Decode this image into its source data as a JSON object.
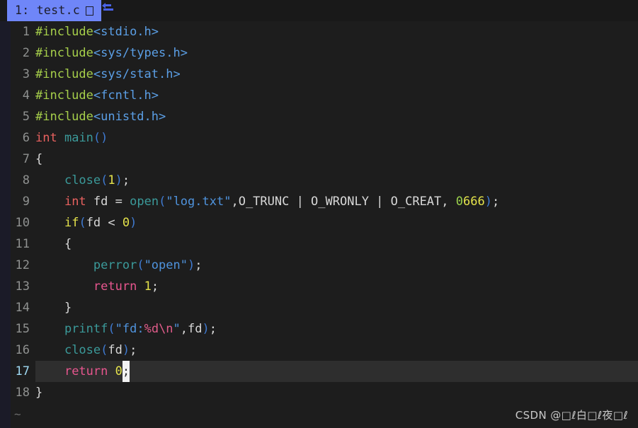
{
  "window": {
    "background": "#1d1d1d",
    "gutter_strip_color": "#1b1b28"
  },
  "tabline": {
    "background": "#191919",
    "active_tab": {
      "label": "1: test.c",
      "modified_glyph": "box-glyph",
      "background": "#6f86f8",
      "text_color": "#1c1c28"
    },
    "fill_glyph_name": "arrow-left-bar-icon",
    "fill_glyph_color": "#4a63e8"
  },
  "editor": {
    "filename": "test.c",
    "language": "c",
    "cursor_line": 17,
    "cursor_column": 14,
    "cursor_char": ";",
    "current_line_highlight": "#2e2e2e",
    "lines": [
      {
        "number": "1",
        "tokens": [
          {
            "t": "#include",
            "c": "tk-pre"
          },
          {
            "t": "<stdio.h>",
            "c": "tk-header"
          }
        ]
      },
      {
        "number": "2",
        "tokens": [
          {
            "t": "#include",
            "c": "tk-pre"
          },
          {
            "t": "<sys/types.h>",
            "c": "tk-header"
          }
        ]
      },
      {
        "number": "3",
        "tokens": [
          {
            "t": "#include",
            "c": "tk-pre"
          },
          {
            "t": "<sys/stat.h>",
            "c": "tk-header"
          }
        ]
      },
      {
        "number": "4",
        "tokens": [
          {
            "t": "#include",
            "c": "tk-pre"
          },
          {
            "t": "<fcntl.h>",
            "c": "tk-header"
          }
        ]
      },
      {
        "number": "5",
        "tokens": [
          {
            "t": "#include",
            "c": "tk-pre"
          },
          {
            "t": "<unistd.h>",
            "c": "tk-header"
          }
        ]
      },
      {
        "number": "6",
        "tokens": [
          {
            "t": "int",
            "c": "tk-type"
          },
          {
            "t": " ",
            "c": "tk-ident"
          },
          {
            "t": "main",
            "c": "tk-func"
          },
          {
            "t": "()",
            "c": "tk-punct"
          }
        ]
      },
      {
        "number": "7",
        "tokens": [
          {
            "t": "{",
            "c": "tk-brace"
          }
        ]
      },
      {
        "number": "8",
        "tokens": [
          {
            "t": "    ",
            "c": "tk-ident"
          },
          {
            "t": "close",
            "c": "tk-func"
          },
          {
            "t": "(",
            "c": "tk-punct"
          },
          {
            "t": "1",
            "c": "tk-num"
          },
          {
            "t": ")",
            "c": "tk-punct"
          },
          {
            "t": ";",
            "c": "tk-semi"
          }
        ]
      },
      {
        "number": "9",
        "tokens": [
          {
            "t": "    ",
            "c": "tk-ident"
          },
          {
            "t": "int",
            "c": "tk-type"
          },
          {
            "t": " fd ",
            "c": "tk-ident"
          },
          {
            "t": "=",
            "c": "tk-op"
          },
          {
            "t": " ",
            "c": "tk-ident"
          },
          {
            "t": "open",
            "c": "tk-func"
          },
          {
            "t": "(",
            "c": "tk-punct"
          },
          {
            "t": "\"log.txt\"",
            "c": "tk-str"
          },
          {
            "t": ",",
            "c": "tk-ident"
          },
          {
            "t": "O_TRUNC | O_WRONLY | O_CREAT, ",
            "c": "tk-ident"
          },
          {
            "t": "0",
            "c": "tk-numoct"
          },
          {
            "t": "666",
            "c": "tk-num"
          },
          {
            "t": ")",
            "c": "tk-punct"
          },
          {
            "t": ";",
            "c": "tk-semi"
          }
        ]
      },
      {
        "number": "10",
        "tokens": [
          {
            "t": "    ",
            "c": "tk-ident"
          },
          {
            "t": "if",
            "c": "tk-cond"
          },
          {
            "t": "(",
            "c": "tk-punct"
          },
          {
            "t": "fd ",
            "c": "tk-ident"
          },
          {
            "t": "<",
            "c": "tk-op"
          },
          {
            "t": " ",
            "c": "tk-ident"
          },
          {
            "t": "0",
            "c": "tk-num"
          },
          {
            "t": ")",
            "c": "tk-punct"
          }
        ]
      },
      {
        "number": "11",
        "tokens": [
          {
            "t": "    {",
            "c": "tk-brace"
          }
        ]
      },
      {
        "number": "12",
        "tokens": [
          {
            "t": "        ",
            "c": "tk-ident"
          },
          {
            "t": "perror",
            "c": "tk-func"
          },
          {
            "t": "(",
            "c": "tk-punct"
          },
          {
            "t": "\"open\"",
            "c": "tk-str"
          },
          {
            "t": ")",
            "c": "tk-punct"
          },
          {
            "t": ";",
            "c": "tk-semi"
          }
        ]
      },
      {
        "number": "13",
        "tokens": [
          {
            "t": "        ",
            "c": "tk-ident"
          },
          {
            "t": "return",
            "c": "tk-kw"
          },
          {
            "t": " ",
            "c": "tk-ident"
          },
          {
            "t": "1",
            "c": "tk-num"
          },
          {
            "t": ";",
            "c": "tk-semi"
          }
        ]
      },
      {
        "number": "14",
        "tokens": [
          {
            "t": "    }",
            "c": "tk-brace"
          }
        ]
      },
      {
        "number": "15",
        "tokens": [
          {
            "t": "    ",
            "c": "tk-ident"
          },
          {
            "t": "printf",
            "c": "tk-func"
          },
          {
            "t": "(",
            "c": "tk-punct"
          },
          {
            "t": "\"fd:",
            "c": "tk-str"
          },
          {
            "t": "%d",
            "c": "tk-esc"
          },
          {
            "t": "\\n",
            "c": "tk-esc"
          },
          {
            "t": "\"",
            "c": "tk-str"
          },
          {
            "t": ",fd",
            "c": "tk-ident"
          },
          {
            "t": ")",
            "c": "tk-punct"
          },
          {
            "t": ";",
            "c": "tk-semi"
          }
        ]
      },
      {
        "number": "16",
        "tokens": [
          {
            "t": "    ",
            "c": "tk-ident"
          },
          {
            "t": "close",
            "c": "tk-func"
          },
          {
            "t": "(",
            "c": "tk-punct"
          },
          {
            "t": "fd",
            "c": "tk-ident"
          },
          {
            "t": ")",
            "c": "tk-punct"
          },
          {
            "t": ";",
            "c": "tk-semi"
          }
        ]
      },
      {
        "number": "17",
        "current": true,
        "tokens": [
          {
            "t": "    ",
            "c": "tk-ident"
          },
          {
            "t": "return",
            "c": "tk-kw"
          },
          {
            "t": " ",
            "c": "tk-ident"
          },
          {
            "t": "0",
            "c": "tk-num"
          },
          {
            "t": ";",
            "c": "tk-semi",
            "cursor": true
          }
        ]
      },
      {
        "number": "18",
        "tokens": [
          {
            "t": "}",
            "c": "tk-brace"
          }
        ]
      }
    ],
    "empty_line_marker": "~"
  },
  "watermark": {
    "text": "CSDN @□ℓ白□ℓ夜□ℓ"
  }
}
